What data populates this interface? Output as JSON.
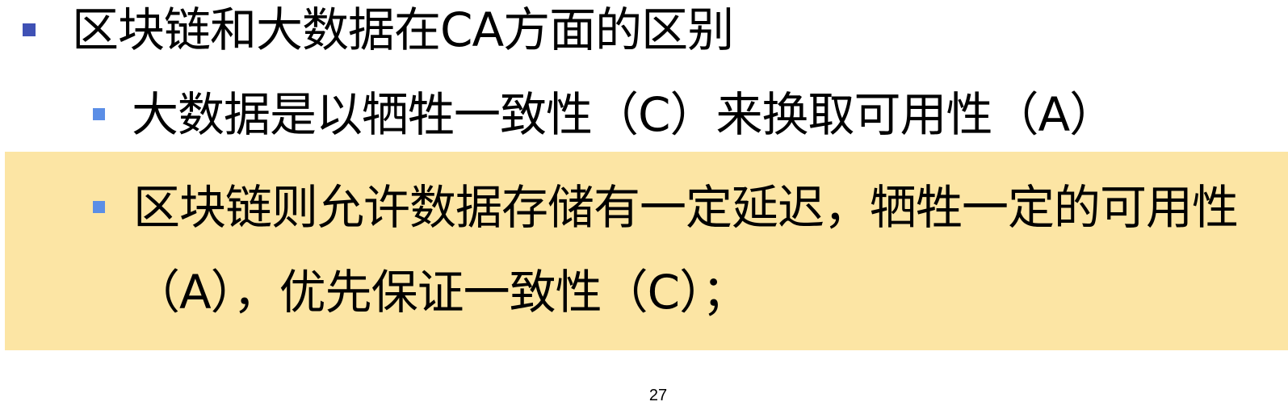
{
  "slide": {
    "title": "区块链和大数据在CA方面的区别",
    "items": [
      {
        "line1": "大数据是以牺牲一致性（C）来换取可用性（A）"
      },
      {
        "line1": "区块链则允许数据存储有一定延迟，牺牲一定的可用性",
        "line2": "（A），优先保证一致性（C）；"
      }
    ],
    "page_number": "27"
  },
  "colors": {
    "bullet_level1": "#3F51B5",
    "bullet_level2": "#5B8EE6",
    "highlight_background": "#FCE5A4"
  }
}
